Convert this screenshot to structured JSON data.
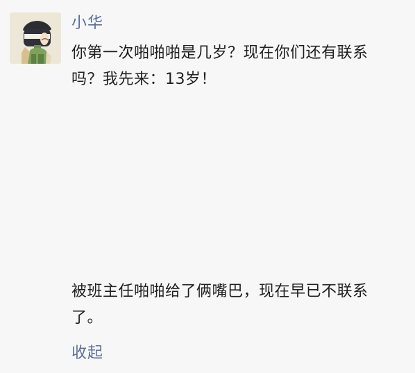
{
  "comment": {
    "author": "小华",
    "avatar_icon": "cartoon-character-avatar-icon",
    "question_line1": "你第一次啪啪啪是几岁？现在你们还有联系",
    "question_line2": "吗？我先来：13岁！"
  },
  "reply": {
    "line1": "被班主任啪啪给了俩嘴巴，现在早已不联系",
    "line2": "了。"
  },
  "actions": {
    "collapse_label": "收起"
  },
  "colors": {
    "background": "#f7f7f7",
    "author_link": "#5b6f97",
    "body_text": "#1f1f1f"
  }
}
